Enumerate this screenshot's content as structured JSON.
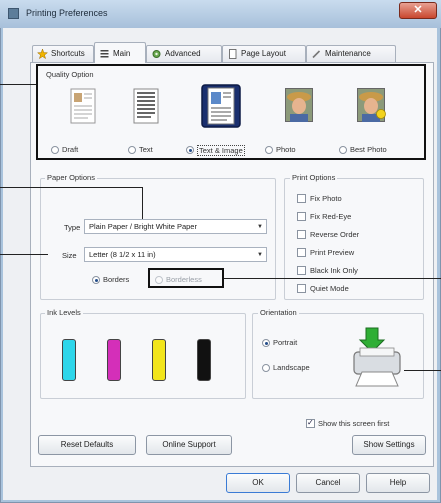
{
  "window": {
    "title": "Printing Preferences",
    "close_symbol": "✕"
  },
  "tabs": [
    {
      "label": "Shortcuts",
      "icon": "star-icon"
    },
    {
      "label": "Main",
      "icon": "printer-settings-icon"
    },
    {
      "label": "Advanced",
      "icon": "tools-icon"
    },
    {
      "label": "Page Layout",
      "icon": "page-icon"
    },
    {
      "label": "Maintenance",
      "icon": "wrench-icon"
    }
  ],
  "quality": {
    "title": "Quality Option",
    "options": [
      {
        "label": "Draft",
        "selected": false
      },
      {
        "label": "Text",
        "selected": false
      },
      {
        "label": "Text & Image",
        "selected": true
      },
      {
        "label": "Photo",
        "selected": false
      },
      {
        "label": "Best Photo",
        "selected": false
      }
    ]
  },
  "paper": {
    "title": "Paper Options",
    "type_label": "Type",
    "type_value": "Plain Paper / Bright White Paper",
    "size_label": "Size",
    "size_value": "Letter (8 1/2 x 11 in)",
    "borders_label": "Borders",
    "borderless_label": "Borderless"
  },
  "print_options": {
    "title": "Print Options",
    "items": [
      {
        "label": "Fix Photo",
        "checked": false
      },
      {
        "label": "Fix Red-Eye",
        "checked": false
      },
      {
        "label": "Reverse Order",
        "checked": false
      },
      {
        "label": "Print Preview",
        "checked": false
      },
      {
        "label": "Black Ink Only",
        "checked": false
      },
      {
        "label": "Quiet Mode",
        "checked": false
      }
    ]
  },
  "ink": {
    "title": "Ink Levels",
    "cartridges": [
      {
        "color": "#2ed6ea"
      },
      {
        "color": "#d42fb9"
      },
      {
        "color": "#f2e51b"
      },
      {
        "color": "#111111"
      }
    ]
  },
  "orientation": {
    "title": "Orientation",
    "portrait_label": "Portrait",
    "landscape_label": "Landscape"
  },
  "show_screen_first": {
    "label": "Show this screen first",
    "checked": true
  },
  "buttons": {
    "reset": "Reset Defaults",
    "online_support": "Online Support",
    "show_settings": "Show Settings",
    "ok": "OK",
    "cancel": "Cancel",
    "help": "Help"
  }
}
